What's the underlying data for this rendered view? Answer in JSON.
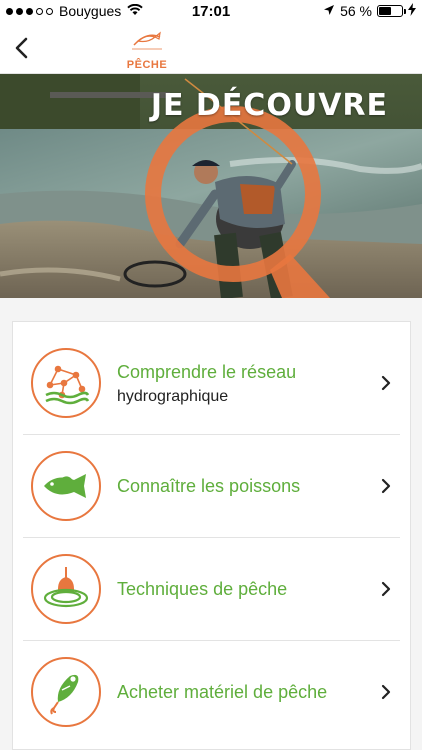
{
  "status_bar": {
    "carrier": "Bouygues",
    "time": "17:01",
    "battery": "56 %",
    "battery_level": 0.56,
    "signal_dots_filled": 3,
    "signal_dots_total": 5
  },
  "nav": {
    "back_icon": "chevron-left-icon",
    "logo_text": "PÊCHE"
  },
  "hero": {
    "title": "JE DÉCOUVRE"
  },
  "menu": {
    "items": [
      {
        "title": "Comprendre le réseau",
        "subtitle": "hydrographique",
        "icon": "network-icon"
      },
      {
        "title": "Connaître les poissons",
        "subtitle": "",
        "icon": "fish-icon"
      },
      {
        "title": "Techniques de pêche",
        "subtitle": "",
        "icon": "float-icon"
      },
      {
        "title": "Acheter matériel de pêche",
        "subtitle": "",
        "icon": "lure-icon"
      }
    ]
  },
  "colors": {
    "accent_orange": "#e8773f",
    "accent_green": "#5fae3c"
  }
}
